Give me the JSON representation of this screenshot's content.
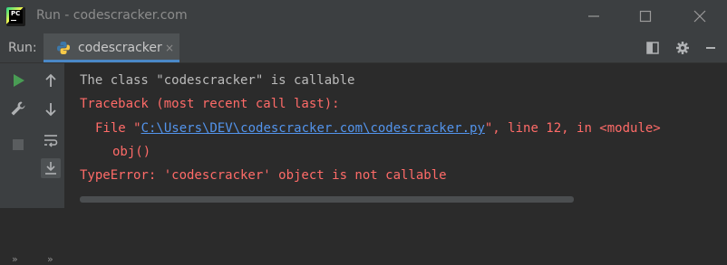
{
  "window": {
    "title": "Run - codescracker.com",
    "logo_text": "PC"
  },
  "run_panel": {
    "label": "Run:",
    "tab_label": "codescracker",
    "tab_close": "×"
  },
  "console": {
    "line1": "The class \"codescracker\" is callable",
    "line2": "Traceback (most recent call last):",
    "line3_prefix": "File \"",
    "line3_link": "C:\\Users\\DEV\\codescracker.com\\codescracker.py",
    "line3_suffix": "\", line 12, in <module>",
    "line4": "obj()",
    "line5": "TypeError: 'codescracker' object is not callable"
  },
  "strip": {
    "more_left": "»",
    "more_right": "»"
  },
  "colors": {
    "error": "#ff6b68",
    "link": "#5394ec",
    "run_green": "#499c54"
  }
}
